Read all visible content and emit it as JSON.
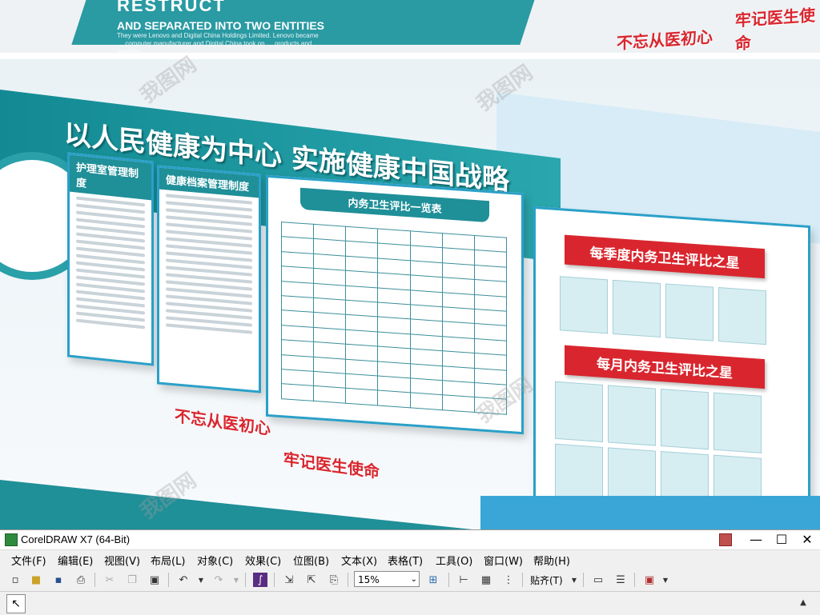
{
  "scene": {
    "top_strip": {
      "heading": "RESTRUCT",
      "subheading": "AND SEPARATED INTO TWO ENTITIES",
      "body": "They were Lenovo and Digital China Holdings Limited. Lenovo became … computer manufacturer and Digital China took on … products and services.",
      "slogan_left": "不忘从医初心",
      "slogan_right": "牢记医生使命"
    },
    "headline": "以人民健康为中心  实施健康中国战略",
    "board1_title": "护理室管理制度",
    "board2_title": "健康档案管理制度",
    "board3_title": "内务卫生评比一览表",
    "ribbon_quarter": "每季度内务卫生评比之星",
    "ribbon_month": "每月内务卫生评比之星",
    "bottom_slogan_left": "不忘从医初心",
    "bottom_slogan_right": "牢记医生使命",
    "watermark": "我图网"
  },
  "app": {
    "title": "CorelDRAW X7 (64-Bit)",
    "window_controls": [
      "—",
      "☐",
      "✕"
    ],
    "menu": [
      "文件(F)",
      "编辑(E)",
      "视图(V)",
      "布局(L)",
      "对象(C)",
      "效果(C)",
      "位图(B)",
      "文本(X)",
      "表格(T)",
      "工具(O)",
      "窗口(W)",
      "帮助(H)"
    ],
    "zoom": "15%",
    "snap_label": "贴齐(T)"
  },
  "colors": {
    "teal": "#1f8f98",
    "red": "#d9262e",
    "blue_border": "#2aa0c8"
  }
}
